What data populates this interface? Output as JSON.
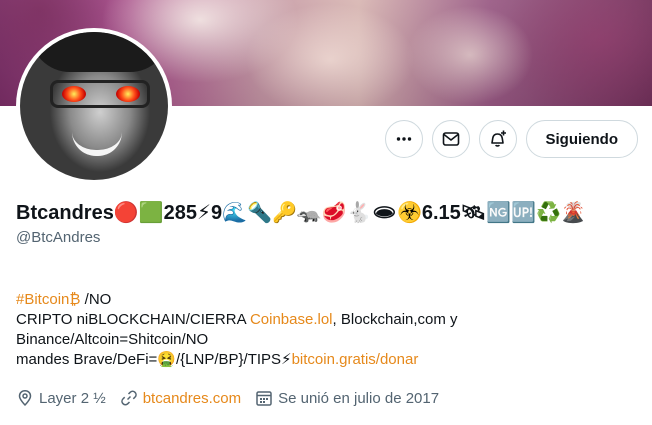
{
  "header": {
    "display_name": "Btcandres🔴🟩285⚡9🌊🔦🔑🦡🥩🐇🕳☣️6.15🛰🆖🆙♻️🌋",
    "handle": "@BtcAndres"
  },
  "actions": {
    "more_icon": "more-icon",
    "message_icon": "envelope-icon",
    "notify_icon": "bell-plus-icon",
    "follow_label": "Siguiendo"
  },
  "bio": {
    "line1_tag": "#Bitcoin",
    "line1_emoji": "₿",
    "line1_rest": " /NO",
    "line2_a": "CRIPTO niBLOCKCHAIN/CIERRA ",
    "line2_link": "Coinbase.lol",
    "line2_b": ", Blockchain,com y",
    "line3": "Binance/Altcoin=Shitcoin/NO",
    "line4_a": "mandes Brave/DeFi=🤮/{LNP/BP}/TIPS⚡",
    "line4_link": "bitcoin.gratis/donar"
  },
  "meta": {
    "location": "Layer 2 ½",
    "website": "btcandres.com",
    "joined": "Se unió en julio de 2017"
  },
  "colors": {
    "link": "#e6891b",
    "secondary_text": "#536471",
    "border": "#cfd9de"
  }
}
